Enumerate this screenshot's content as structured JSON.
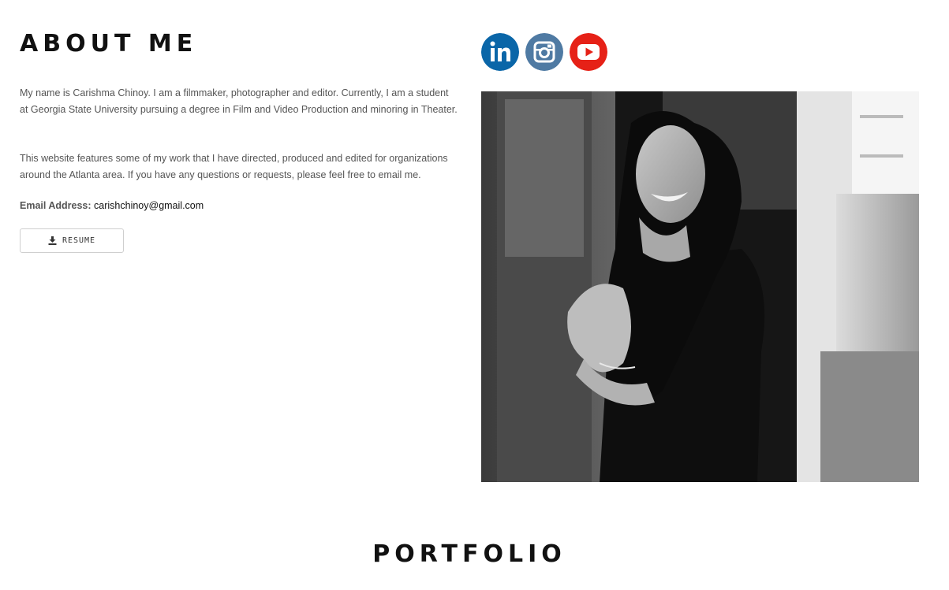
{
  "about": {
    "title": "ABOUT ME",
    "paragraph1": "My name is Carishma Chinoy. I am a filmmaker, photographer and editor. Currently, I am a student at Georgia State University pursuing a degree in Film and Video Production and minoring in Theater.",
    "paragraph2": "This website features some of my work that I have directed, produced and edited for organizations around the Atlanta area. If you have any questions or requests, please feel free to email me.",
    "email_label": "Email Address:",
    "email": "carishchinoy@gmail.com",
    "resume_label": "RESUME"
  },
  "social": {
    "linkedin": {
      "icon": "linkedin-icon",
      "color": "#0a66a8"
    },
    "instagram": {
      "icon": "instagram-icon",
      "color": "#4f7aa3"
    },
    "youtube": {
      "icon": "youtube-icon",
      "color": "#e62117"
    }
  },
  "portfolio": {
    "title": "PORTFOLIO"
  }
}
